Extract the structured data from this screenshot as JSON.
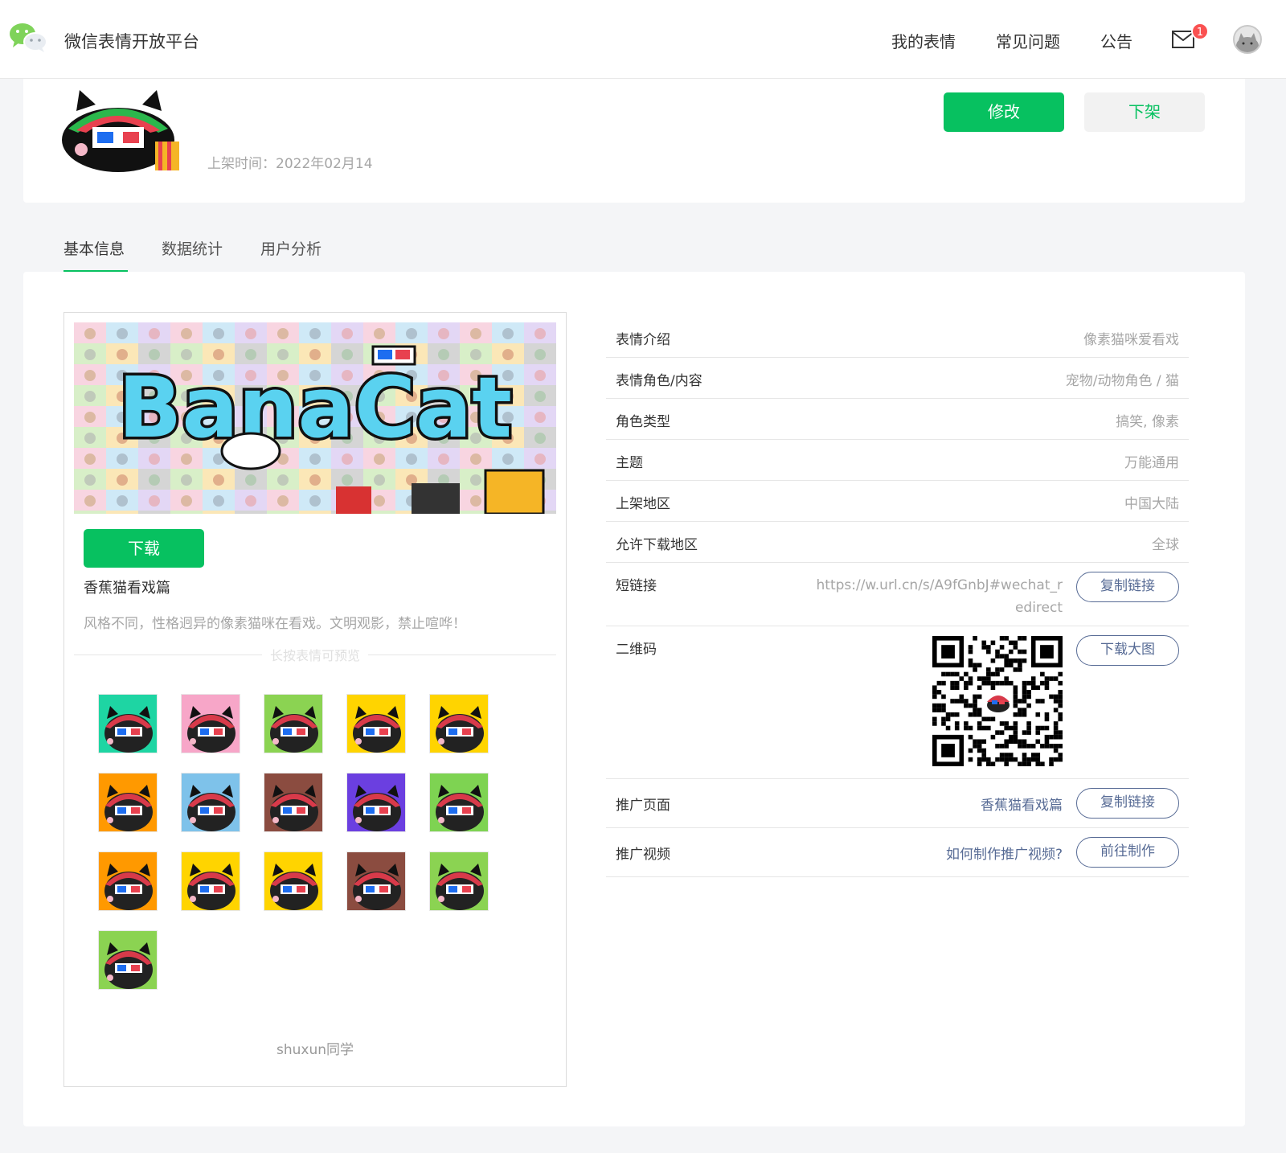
{
  "header": {
    "brand": "微信表情开放平台",
    "nav": [
      "我的表情",
      "常见问题",
      "公告"
    ],
    "mail_count": "1",
    "icons": {
      "logo": "wechat-logo-icon",
      "mail": "mail-icon",
      "avatar": "user-avatar"
    }
  },
  "pack": {
    "release_time": "上架时间：2022年02月14",
    "edit_label": "修改",
    "offline_label": "下架"
  },
  "tabs": [
    "基本信息",
    "数据统计",
    "用户分析"
  ],
  "preview": {
    "banner_text": "BanaCat",
    "download_label": "下载",
    "name": "香蕉猫看戏篇",
    "description": "风格不同，性格迥异的像素猫咪在看戏。文明观影，禁止喧哗！",
    "hint": "长按表情可预览",
    "author": "shuxun同学",
    "sticker_backgrounds": [
      "#1ed5a3",
      "#f7a6c8",
      "#8bd352",
      "#ffd400",
      "#ffd400",
      "#ff9900",
      "#7ec2ea",
      "#8b4c40",
      "#6b3fe0",
      "#7ed352",
      "#ff9900",
      "#ffd400",
      "#ffd400",
      "#8b4c40",
      "#8bd352",
      "#8bd352"
    ]
  },
  "info": {
    "rows": [
      {
        "label": "表情介绍",
        "value": "像素猫咪爱看戏"
      },
      {
        "label": "表情角色/内容",
        "value": "宠物/动物角色 / 猫"
      },
      {
        "label": "角色类型",
        "value": "搞笑, 像素"
      },
      {
        "label": "主题",
        "value": "万能通用"
      },
      {
        "label": "上架地区",
        "value": "中国大陆"
      },
      {
        "label": "允许下载地区",
        "value": "全球"
      }
    ],
    "short_link": {
      "label": "短链接",
      "value_line1": "https://w.url.cn/s/A9fGnbJ#wechat_r",
      "value_line2": "edirect",
      "button": "复制链接"
    },
    "qrcode": {
      "label": "二维码",
      "button": "下载大图"
    },
    "promo_page": {
      "label": "推广页面",
      "value": "香蕉猫看戏篇",
      "button": "复制链接"
    },
    "promo_video": {
      "label": "推广视频",
      "value": "如何制作推广视频?",
      "button": "前往制作"
    }
  }
}
